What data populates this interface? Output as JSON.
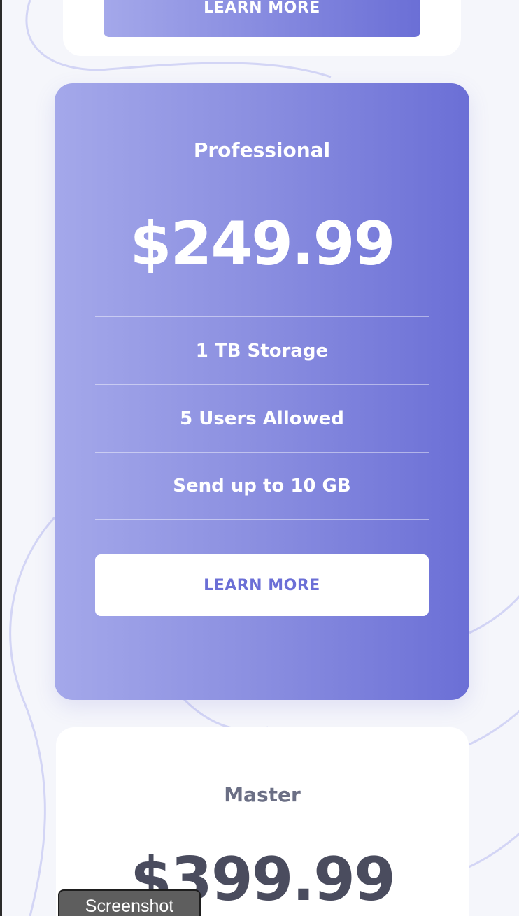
{
  "basic_card": {
    "button_label": "LEARN MORE"
  },
  "professional_card": {
    "title": "Professional",
    "price": "$249.99",
    "features": [
      "1 TB Storage",
      "5 Users Allowed",
      "Send up to 10 GB"
    ],
    "button_label": "LEARN MORE"
  },
  "master_card": {
    "title": "Master",
    "price": "$399.99"
  },
  "overlay": {
    "screenshot_label": "Screenshot"
  },
  "colors": {
    "background": "#f5f6fb",
    "accent_start": "#a4a8ea",
    "accent_end": "#6b6fd6",
    "muted_title": "#6b6f85",
    "dark_price": "#4a4c5e"
  }
}
